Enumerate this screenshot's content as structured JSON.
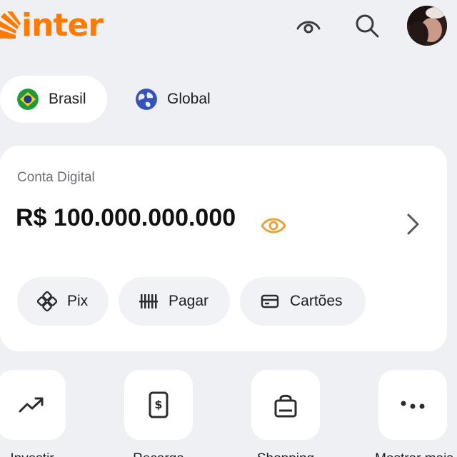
{
  "header": {
    "logo_text": "inter",
    "brand_color": "#ff7a00",
    "icons": [
      "eye-icon",
      "search-icon",
      "avatar"
    ]
  },
  "region_toggle": {
    "options": [
      {
        "label": "Brasil",
        "selected": true
      },
      {
        "label": "Global",
        "selected": false
      }
    ]
  },
  "account": {
    "label": "Conta Digital",
    "balance": "R$ 100.000.000.000",
    "accent_color": "#ff7a00",
    "actions": [
      {
        "label": "Pix",
        "icon": "pix-icon"
      },
      {
        "label": "Pagar",
        "icon": "barcode-icon"
      },
      {
        "label": "Cartões",
        "icon": "card-icon"
      }
    ]
  },
  "shortcuts": [
    {
      "label": "Investir",
      "icon": "trending-up-icon"
    },
    {
      "label": "Recarga",
      "icon": "phone-dollar-icon"
    },
    {
      "label": "Shopping",
      "icon": "shopping-bag-icon"
    },
    {
      "label": "Mostrar mais",
      "icon": "more-icon"
    }
  ]
}
